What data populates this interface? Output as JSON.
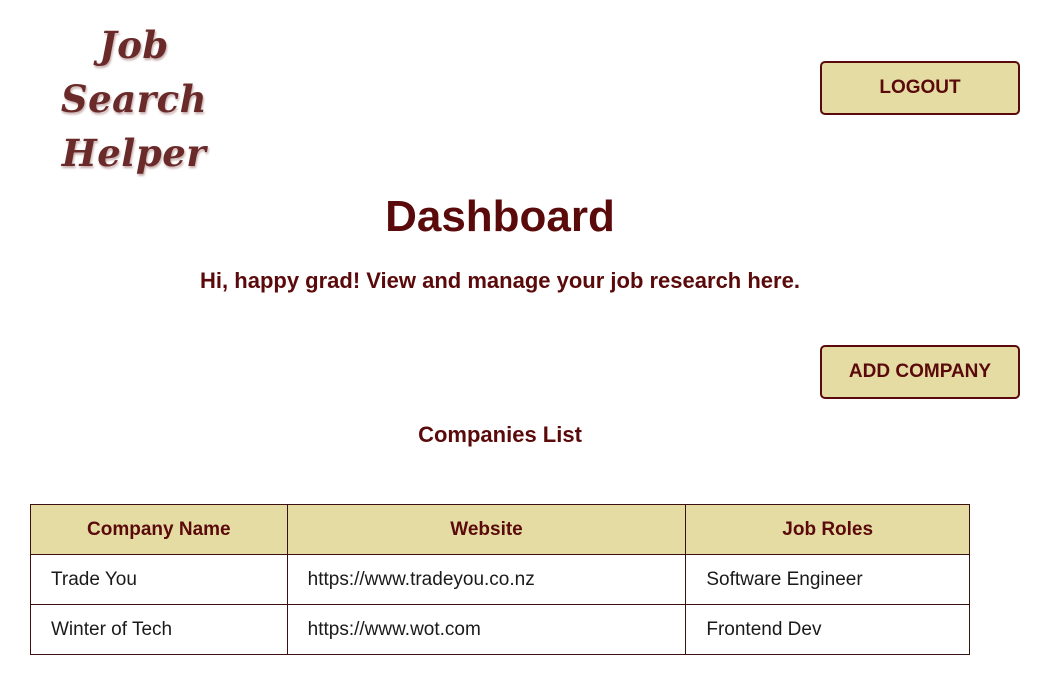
{
  "header": {
    "logo_line1": "Job Search",
    "logo_line2": "Helper",
    "logout_label": "LOGOUT"
  },
  "main": {
    "title": "Dashboard",
    "subtitle": "Hi, happy grad! View and manage your job research here.",
    "add_company_label": "ADD COMPANY",
    "list_heading": "Companies List"
  },
  "table": {
    "headers": [
      "Company Name",
      "Website",
      "Job Roles"
    ],
    "rows": [
      [
        "Trade You",
        "https://www.tradeyou.co.nz",
        "Software Engineer"
      ],
      [
        "Winter of Tech",
        "https://www.wot.com",
        "Frontend Dev"
      ]
    ]
  },
  "colors": {
    "accent": "#e5dca4",
    "text": "#5a0a0a"
  }
}
